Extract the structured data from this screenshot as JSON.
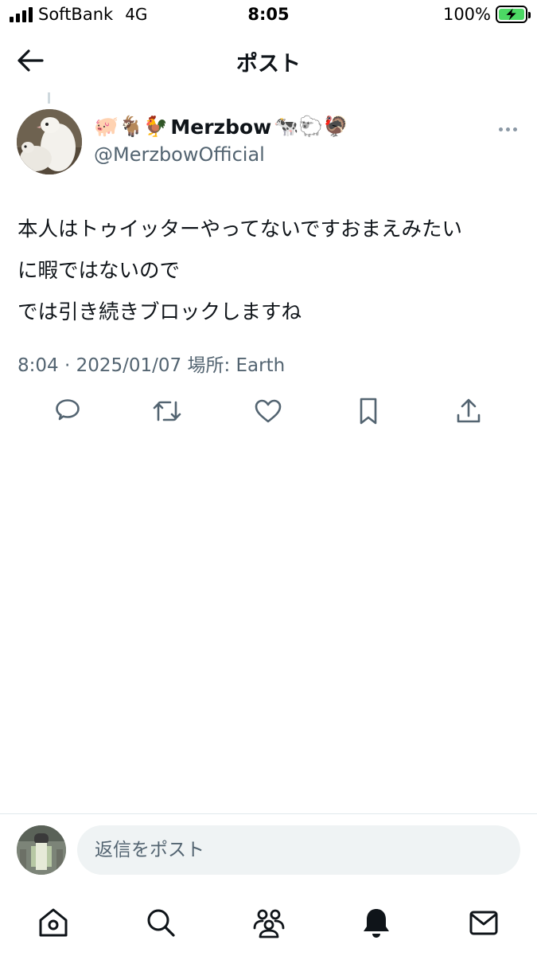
{
  "status_bar": {
    "carrier": "SoftBank",
    "network": "4G",
    "time": "8:05",
    "battery_percent": "100%",
    "battery_level": 1.0,
    "battery_color": "#4cd964"
  },
  "header": {
    "title": "ポスト",
    "back_icon": "arrow-left-icon"
  },
  "post": {
    "author": {
      "name_prefix_emoji": "🐖🐐🐓",
      "name": "Merzbow",
      "name_suffix_emoji": "🐄🐑🦃",
      "handle": "@MerzbowOfficial"
    },
    "text_lines": [
      "本人はトゥイッターやってないですおまえみたい",
      "に暇ではないので",
      "では引き続きブロックしますね"
    ],
    "timestamp": "8:04 · 2025/01/07",
    "location_label": "場所: Earth",
    "actions": [
      "reply-icon",
      "retweet-icon",
      "like-icon",
      "bookmark-icon",
      "share-icon"
    ]
  },
  "reply_bar": {
    "placeholder": "返信をポスト"
  },
  "tab_bar": {
    "items": [
      "home-icon",
      "search-icon",
      "communities-icon",
      "notifications-icon",
      "messages-icon"
    ]
  },
  "colors": {
    "text": "#0f1419",
    "secondary": "#536471",
    "input_bg": "#eff3f4"
  }
}
